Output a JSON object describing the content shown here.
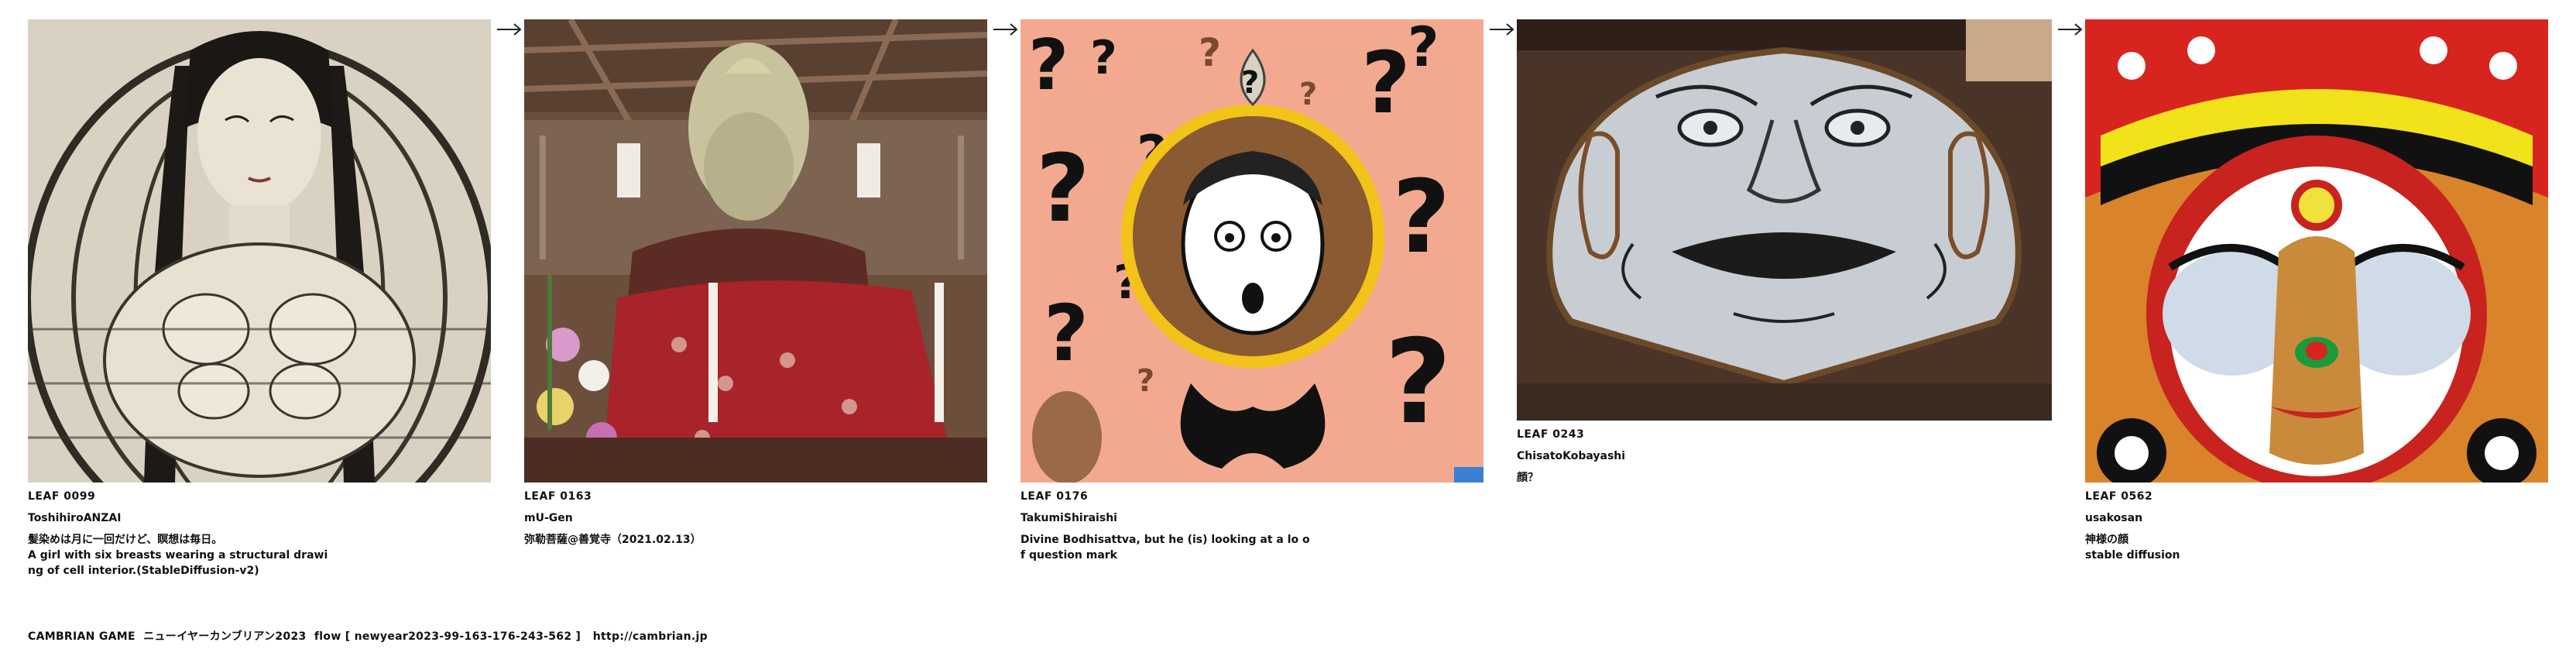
{
  "leaves": [
    {
      "number": "LEAF 0099",
      "author": "ToshihiroANZAI",
      "description": "髪染めは月に一回だけど、瞑想は毎日。\nA girl with six breasts wearing a structural drawi\nng of cell interior.(StableDiffusion-v2)",
      "image_subject": "sepia drawing of a woman inside a cage-like structure"
    },
    {
      "number": "LEAF 0163",
      "author": "mU-Gen",
      "description": "弥勒菩薩@善覚寺（2021.02.13）",
      "image_subject": "photo of a stone statue draped in red cloth inside a wooden temple"
    },
    {
      "number": "LEAF 0176",
      "author": "TakumiShiraishi",
      "description": "Divine Bodhisattva, but he (is) looking at a lo o\nf  question mark",
      "image_subject": "cartoon face surrounded by question marks on a salmon background"
    },
    {
      "number": "LEAF 0243",
      "author": "ChisatoKobayashi",
      "description": "顔？",
      "image_subject": "photo of a ceramic plate shaped like a face"
    },
    {
      "number": "LEAF 0562",
      "author": "usakosan",
      "description": "神様の顔\nstable diffusion",
      "image_subject": "colorful painted deity face with headdress"
    }
  ],
  "arrow_icon": "arrow-right-icon",
  "footer": {
    "text": "CAMBRIAN GAME  ニューイヤーカンブリアン2023  flow [ newyear2023-99-163-176-243-562 ]   http://cambrian.jp"
  },
  "colors": {
    "background": "#ffffff",
    "text": "#111111"
  }
}
